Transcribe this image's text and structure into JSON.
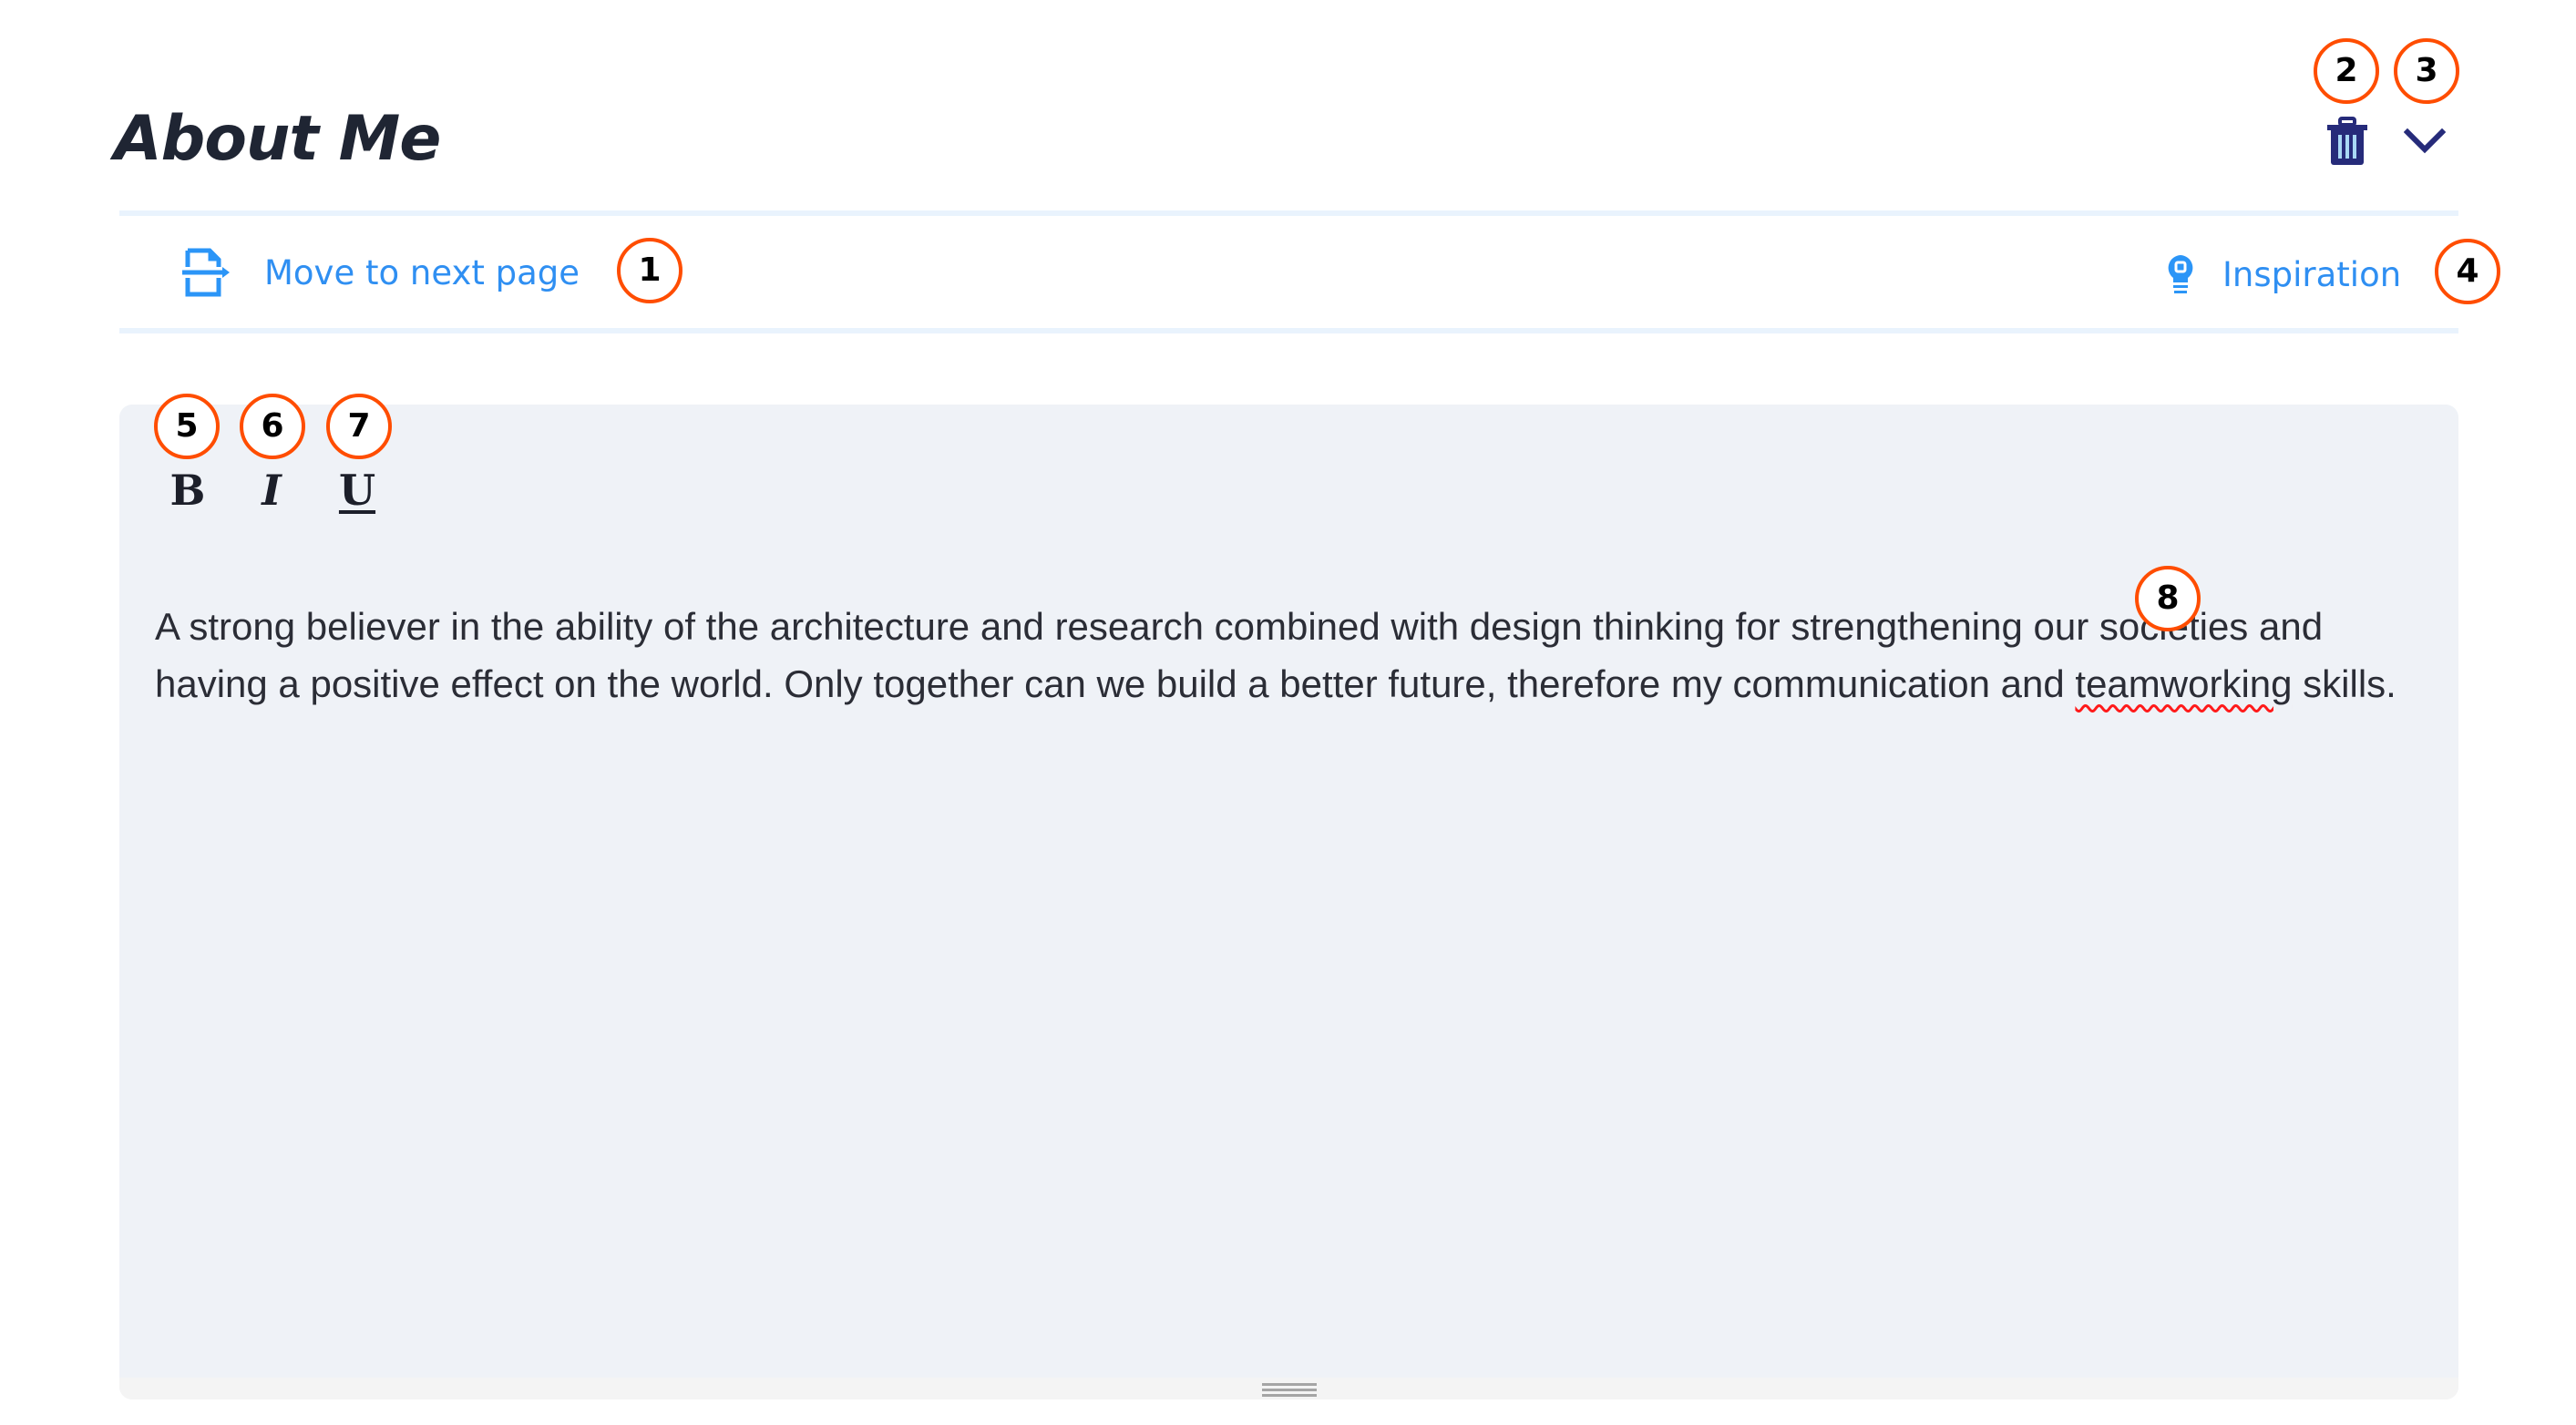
{
  "section": {
    "title": "About Me",
    "delete_icon": "trash-icon",
    "collapse_icon": "chevron-down-icon"
  },
  "actions": {
    "move_next_page": {
      "label": "Move to next page",
      "icon": "move-page-icon"
    },
    "inspiration": {
      "label": "Inspiration",
      "icon": "lightbulb-icon"
    }
  },
  "editor": {
    "toolbar": {
      "bold": "B",
      "italic": "I",
      "underline": "U"
    },
    "content": {
      "before_error": "A strong believer in the ability of the architecture and research combined with design thinking for strengthening our societies and having a positive effect on the world. Only together can we build a better future, therefore my communication and ",
      "misspelled_word": "teamworking",
      "after_error": " skills."
    },
    "resize_handle_icon": "resize-grip-icon"
  },
  "annotations": [
    "1",
    "2",
    "3",
    "4",
    "5",
    "6",
    "7",
    "8"
  ],
  "colors": {
    "accent": "#2f8ff2",
    "icon_dark": "#262b7a",
    "title": "#1f2533",
    "editor_bg": "#eff2f7",
    "divider": "#e9f3fd",
    "badge_ring": "#ff4d00",
    "spellcheck": "#ff1a1a"
  }
}
